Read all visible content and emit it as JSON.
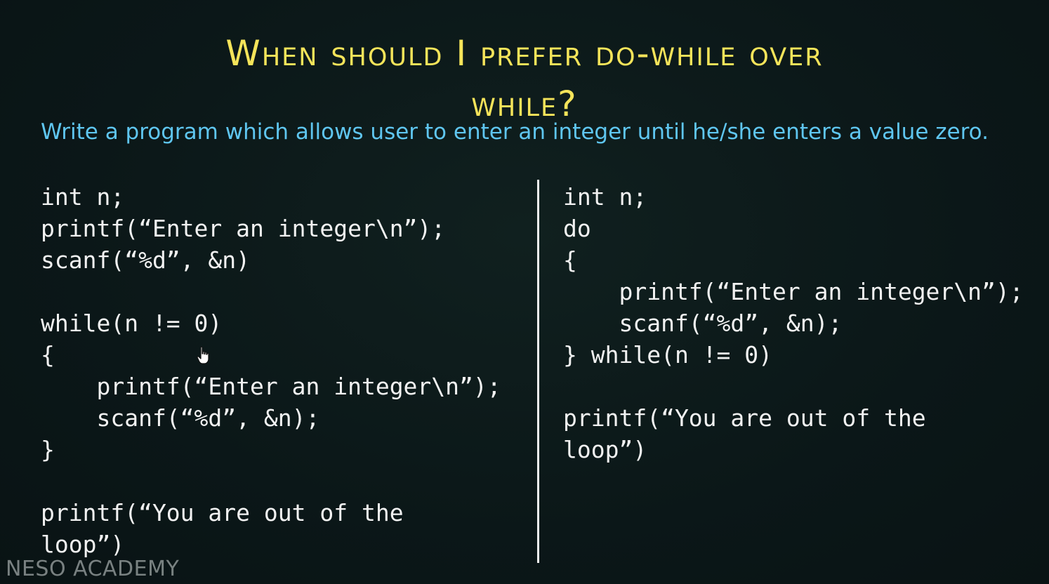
{
  "slide": {
    "title_line1": "When should I prefer do-while over",
    "title_line2": "while?",
    "subtitle": "Write a program which allows user to enter an integer until he/she enters a value zero.",
    "watermark": "NESO ACADEMY"
  },
  "left_code": {
    "lines": [
      "int n;",
      "printf(“Enter an integer\\n”);",
      "scanf(“%d”, &n)",
      "",
      "while(n != 0)",
      "{",
      "    printf(“Enter an integer\\n”);",
      "    scanf(“%d”, &n);",
      "}",
      "",
      "printf(“You are out of the",
      "loop”)"
    ]
  },
  "right_code": {
    "lines": [
      "int n;",
      "do",
      "{",
      "    printf(“Enter an integer\\n”);",
      "    scanf(“%d”, &n);",
      "} while(n != 0)",
      "",
      "printf(“You are out of the",
      "loop”)"
    ]
  },
  "colors": {
    "title": "#f5e45a",
    "subtitle": "#5fc6f0",
    "code": "#f2f2f2",
    "background": "#0c1819"
  },
  "icons": {
    "cursor": "hand-pointer-icon"
  }
}
